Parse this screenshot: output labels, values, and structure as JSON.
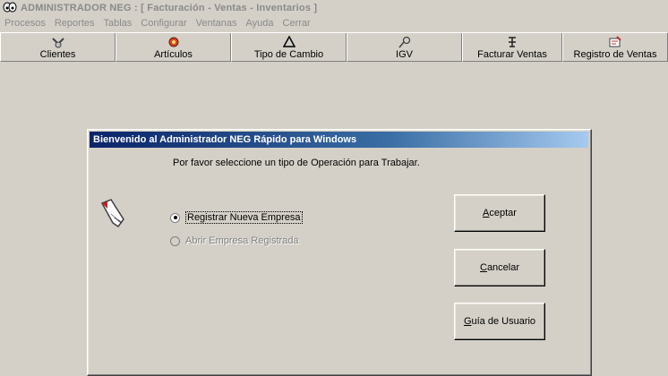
{
  "window": {
    "title": "ADMINISTRADOR NEG : [ Facturación - Ventas - Inventarios ]"
  },
  "menu": [
    "Procesos",
    "Reportes",
    "Tablas",
    "Configurar",
    "Ventanas",
    "Ayuda",
    "Cerrar"
  ],
  "toolbar": [
    {
      "label": "Clientes",
      "icon": "clients-icon"
    },
    {
      "label": "Artículos",
      "icon": "articles-icon"
    },
    {
      "label": "Tipo de Cambio",
      "icon": "delta-icon"
    },
    {
      "label": "IGV",
      "icon": "tax-icon"
    },
    {
      "label": "Facturar Ventas",
      "icon": "invoice-icon"
    },
    {
      "label": "Registro de Ventas",
      "icon": "sales-register-icon"
    }
  ],
  "dialog": {
    "title": "Bienvenido al Administrador NEG Rápido para Windows",
    "prompt": "Por favor seleccione un tipo de Operación para Trabajar.",
    "options": [
      {
        "label": "Registrar Nueva Empresa",
        "selected": true,
        "enabled": true
      },
      {
        "label": "Abrir Empresa Registrada",
        "selected": false,
        "enabled": false
      }
    ],
    "buttons": {
      "accept_mnemonic": "A",
      "accept_rest": "ceptar",
      "cancel_mnemonic": "C",
      "cancel_rest": "ancelar",
      "guide_mnemonic": "G",
      "guide_rest": "uía de Usuario"
    }
  }
}
